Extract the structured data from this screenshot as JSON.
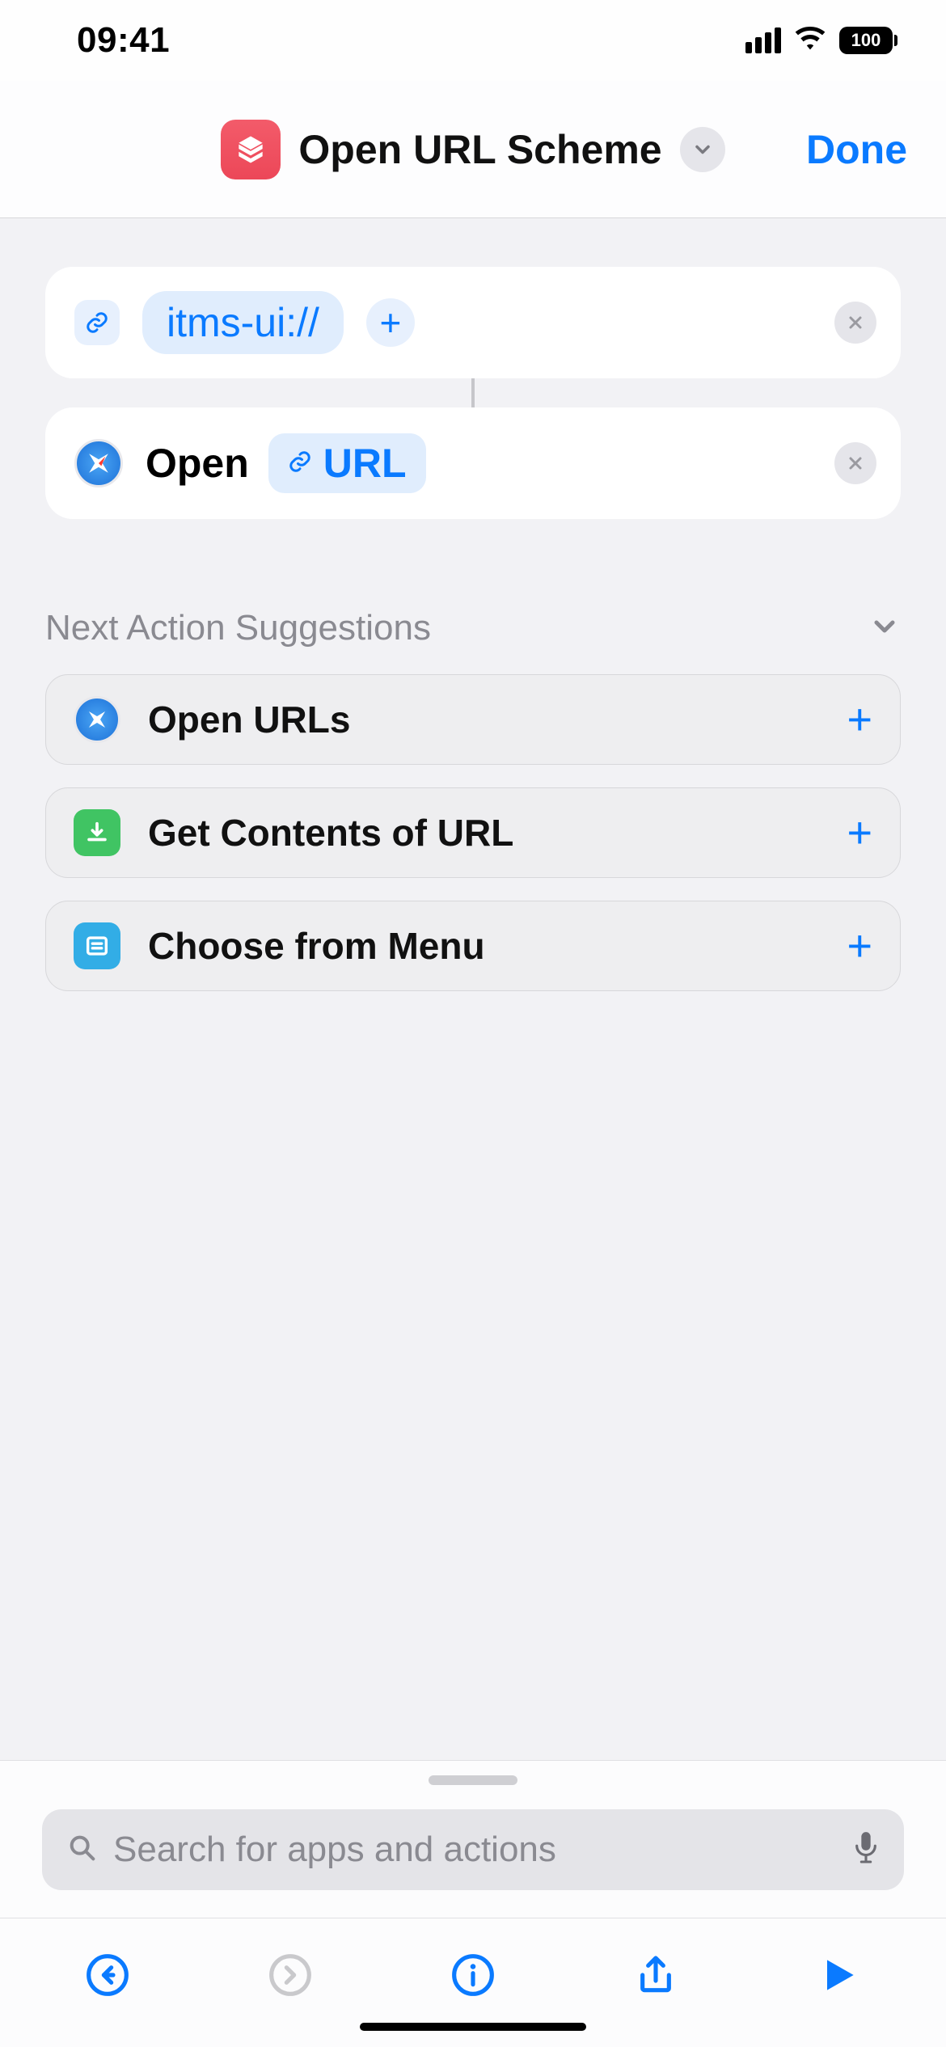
{
  "status": {
    "time": "09:41",
    "battery": "100"
  },
  "header": {
    "title": "Open URL Scheme",
    "done": "Done"
  },
  "actions": {
    "url_value": "itms-ui://",
    "open_label": "Open",
    "open_param": "URL"
  },
  "suggestions": {
    "heading": "Next Action Suggestions",
    "items": [
      {
        "label": "Open URLs"
      },
      {
        "label": "Get Contents of URL"
      },
      {
        "label": "Choose from Menu"
      }
    ]
  },
  "search": {
    "placeholder": "Search for apps and actions"
  }
}
